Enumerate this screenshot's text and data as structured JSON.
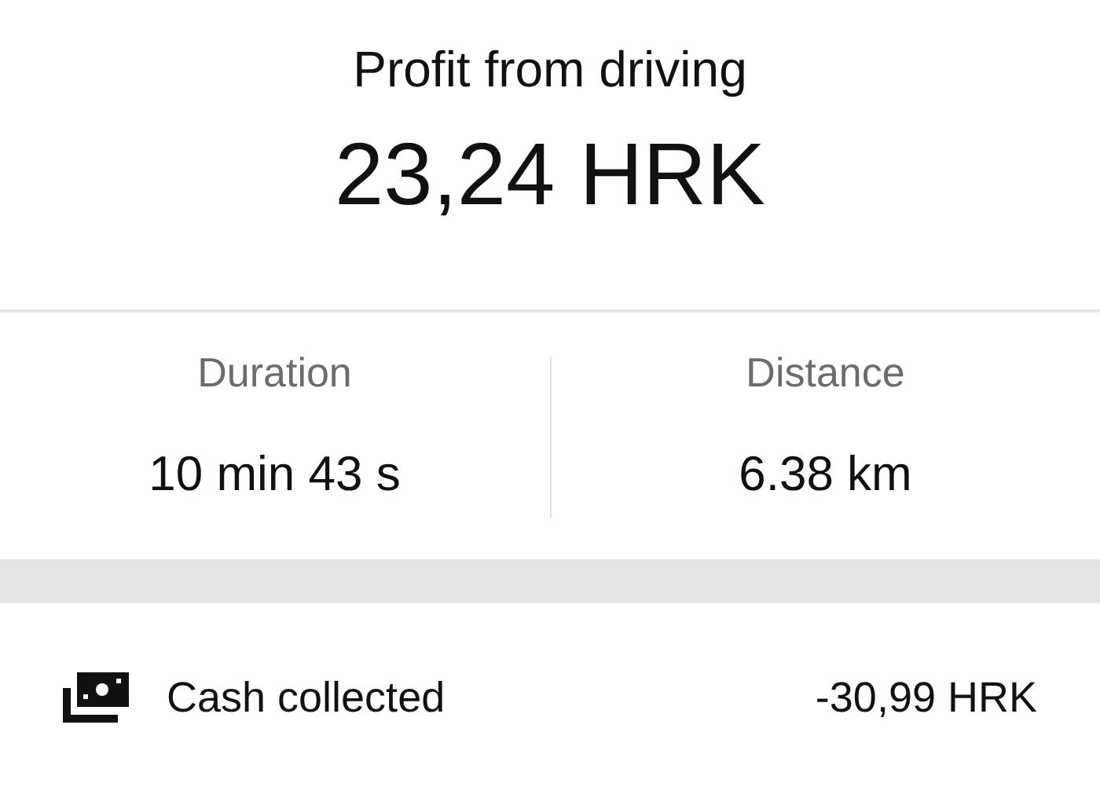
{
  "header": {
    "title": "Profit from driving",
    "amount": "23,24 HRK"
  },
  "stats": [
    {
      "label": "Duration",
      "value": "10 min 43 s"
    },
    {
      "label": "Distance",
      "value": "6.38 km"
    }
  ],
  "items": [
    {
      "label": "Cash collected",
      "amount": "-30,99 HRK"
    }
  ]
}
